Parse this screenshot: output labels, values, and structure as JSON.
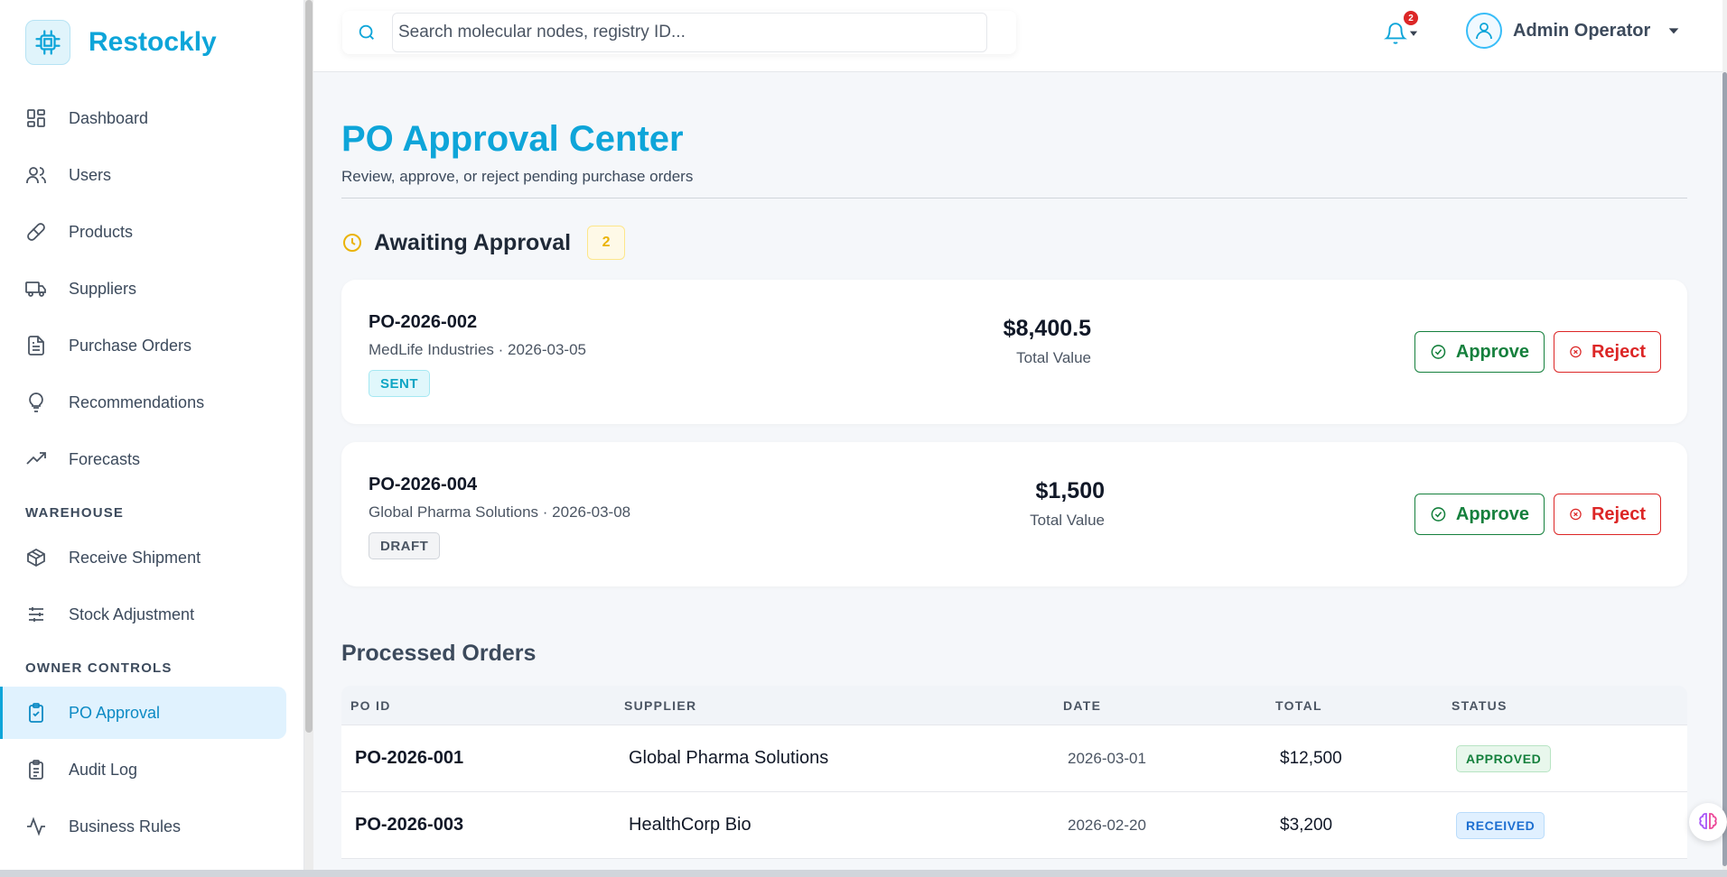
{
  "brand": {
    "name": "Restockly"
  },
  "sidebar": {
    "items": [
      {
        "label": "Dashboard",
        "icon": "dashboard-icon"
      },
      {
        "label": "Users",
        "icon": "users-icon"
      },
      {
        "label": "Products",
        "icon": "pill-icon"
      },
      {
        "label": "Suppliers",
        "icon": "truck-icon"
      },
      {
        "label": "Purchase Orders",
        "icon": "document-icon"
      },
      {
        "label": "Recommendations",
        "icon": "lightbulb-icon"
      },
      {
        "label": "Forecasts",
        "icon": "trending-icon"
      }
    ],
    "warehouse_heading": "WAREHOUSE",
    "warehouse_items": [
      {
        "label": "Receive Shipment",
        "icon": "package-icon"
      },
      {
        "label": "Stock Adjustment",
        "icon": "sliders-icon"
      }
    ],
    "owner_heading": "OWNER CONTROLS",
    "owner_items": [
      {
        "label": "PO Approval",
        "icon": "clipboard-check-icon",
        "active": true
      },
      {
        "label": "Audit Log",
        "icon": "clipboard-list-icon"
      },
      {
        "label": "Business Rules",
        "icon": "activity-icon"
      }
    ]
  },
  "topbar": {
    "search_placeholder": "Search molecular nodes, registry ID...",
    "notification_count": "2",
    "user_name": "Admin Operator"
  },
  "page": {
    "title": "PO Approval Center",
    "subtitle": "Review, approve, or reject pending purchase orders"
  },
  "awaiting": {
    "title": "Awaiting Approval",
    "count": "2",
    "cards": [
      {
        "id": "PO-2026-002",
        "meta": "MedLife Industries · 2026-03-05",
        "status": "SENT",
        "amount": "$8,400.5",
        "amount_label": "Total Value",
        "approve_label": "Approve",
        "reject_label": "Reject"
      },
      {
        "id": "PO-2026-004",
        "meta": "Global Pharma Solutions · 2026-03-08",
        "status": "DRAFT",
        "amount": "$1,500",
        "amount_label": "Total Value",
        "approve_label": "Approve",
        "reject_label": "Reject"
      }
    ]
  },
  "processed": {
    "title": "Processed Orders",
    "columns": [
      "PO ID",
      "SUPPLIER",
      "DATE",
      "TOTAL",
      "STATUS"
    ],
    "rows": [
      {
        "id": "PO-2026-001",
        "supplier": "Global Pharma Solutions",
        "date": "2026-03-01",
        "total": "$12,500",
        "status": "APPROVED"
      },
      {
        "id": "PO-2026-003",
        "supplier": "HealthCorp Bio",
        "date": "2026-02-20",
        "total": "$3,200",
        "status": "RECEIVED"
      }
    ]
  },
  "colors": {
    "accent": "#0ea5d9",
    "approve": "#15803d",
    "reject": "#dc2626",
    "pending": "#eab308"
  }
}
